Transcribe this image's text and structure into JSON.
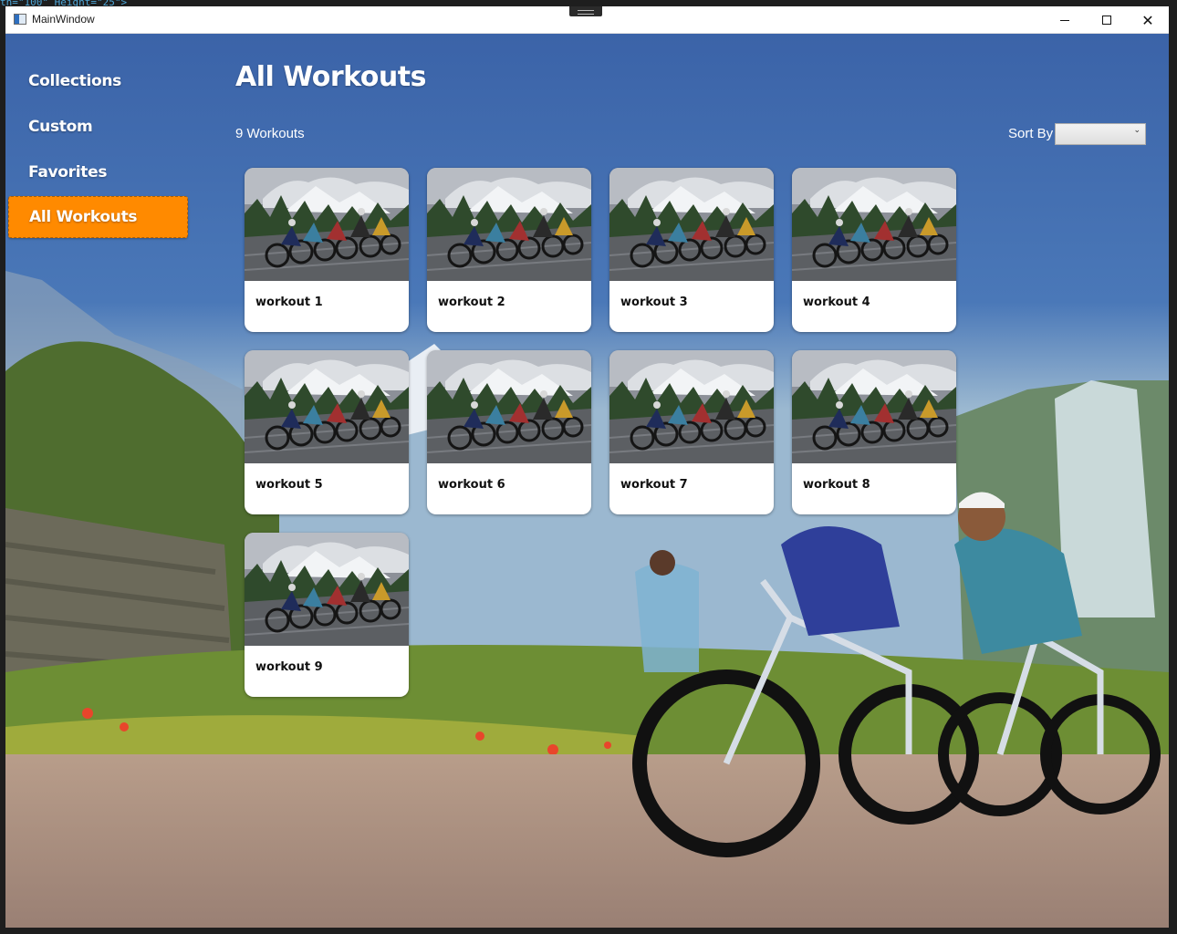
{
  "background_code_fragment": "th=\"100\" Height=\"25\">",
  "window": {
    "title": "MainWindow",
    "controls": [
      "minimize",
      "maximize",
      "close"
    ]
  },
  "sidebar": {
    "items": [
      {
        "label": "Collections",
        "active": false
      },
      {
        "label": "Custom",
        "active": false
      },
      {
        "label": "Favorites",
        "active": false
      },
      {
        "label": "All Workouts",
        "active": true
      }
    ]
  },
  "main": {
    "title": "All Workouts",
    "count_text": "9 Workouts",
    "sort": {
      "label": "Sort By",
      "selected": ""
    },
    "workouts": [
      {
        "name": "workout 1"
      },
      {
        "name": "workout 2"
      },
      {
        "name": "workout 3"
      },
      {
        "name": "workout 4"
      },
      {
        "name": "workout 5"
      },
      {
        "name": "workout 6"
      },
      {
        "name": "workout 7"
      },
      {
        "name": "workout 8"
      },
      {
        "name": "workout 9"
      }
    ]
  },
  "colors": {
    "accent": "#ff8a00",
    "text_on_bg": "#ffffff",
    "card_bg": "#ffffff"
  },
  "icons": {
    "app": "window-app-icon",
    "minimize": "minimize-icon",
    "maximize": "maximize-icon",
    "close": "close-icon",
    "sort": "chevron-down-icon"
  }
}
